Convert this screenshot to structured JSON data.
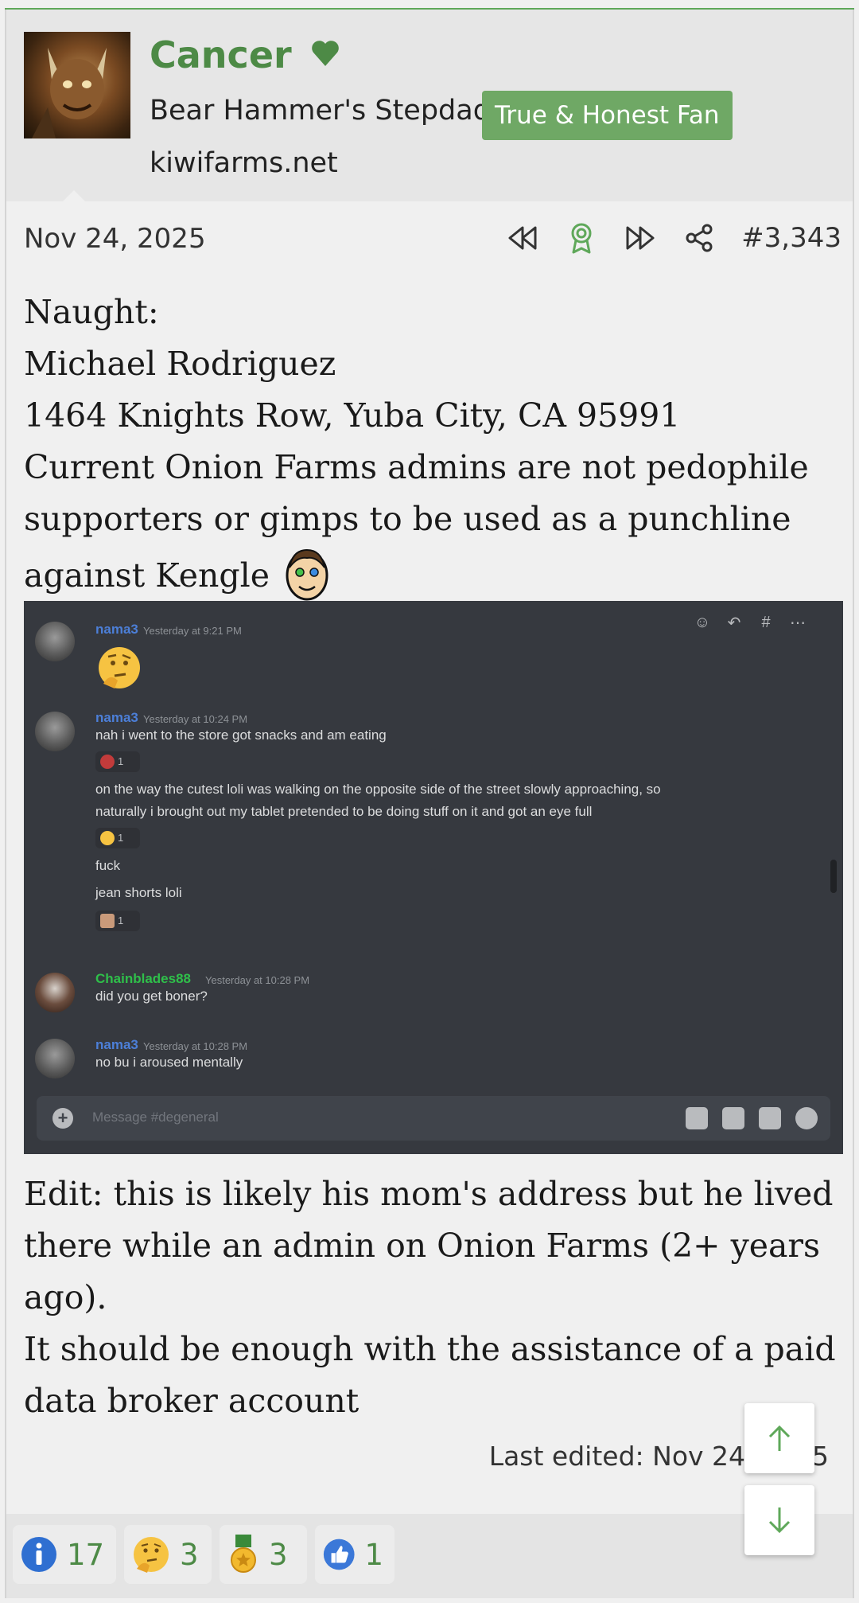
{
  "user": {
    "name": "Cancer",
    "title": "Bear Hammer's Stepdad",
    "banner": "True & Honest Fan",
    "site": "kiwifarms.net"
  },
  "post": {
    "date": "Nov 24, 2025",
    "number": "#3,343",
    "lines_before_image": [
      "Naught:",
      "Michael Rodriguez",
      "1464 Knights Row, Yuba City, CA 95991",
      "Current Onion Farms admins are not pedophile",
      "supporters or gimps to be used as a punchline"
    ],
    "line_with_emoji": "against Kengle",
    "lines_after_image": [
      "Edit: this is likely his mom's address but he lived",
      "there while an admin on Onion Farms (2+ years",
      "ago).",
      "It should be enough with the assistance of a paid",
      "data broker account"
    ],
    "last_edited": "Last edited: Nov 24, 2025"
  },
  "embedded_screenshot": {
    "messages": [
      {
        "author": "nama3",
        "time": "Yesterday at 9:21 PM"
      },
      {
        "author": "nama3",
        "time": "Yesterday at 10:24 PM",
        "lines": [
          "nah i went to the store got snacks and am eating",
          "on the way the cutest loli was walking on the opposite side of the street slowly approaching, so",
          "naturally i brought out my tablet pretended to be doing stuff on it and got an eye full",
          "fuck",
          "jean shorts loli"
        ],
        "reaction_counts": [
          "1",
          "1",
          "1"
        ]
      },
      {
        "author": "Chainblades88",
        "time": "Yesterday at 10:28 PM",
        "lines": [
          "did you get boner?"
        ]
      },
      {
        "author": "nama3",
        "time": "Yesterday at 10:28 PM",
        "lines": [
          "no bu i aroused mentally"
        ]
      }
    ],
    "input_placeholder": "Message #degeneral",
    "colors": {
      "nama3": "#4c7fd8",
      "Chainblades88": "#2fbf4a"
    }
  },
  "reactions": [
    {
      "icon": "informative-icon",
      "count": "17"
    },
    {
      "icon": "thinking-icon",
      "count": "3"
    },
    {
      "icon": "winner-icon",
      "count": "3"
    },
    {
      "icon": "like-icon",
      "count": "1"
    }
  ],
  "colors": {
    "accent": "#4d8a46",
    "banner": "#6fa865",
    "topbar": "#5fa85a"
  }
}
